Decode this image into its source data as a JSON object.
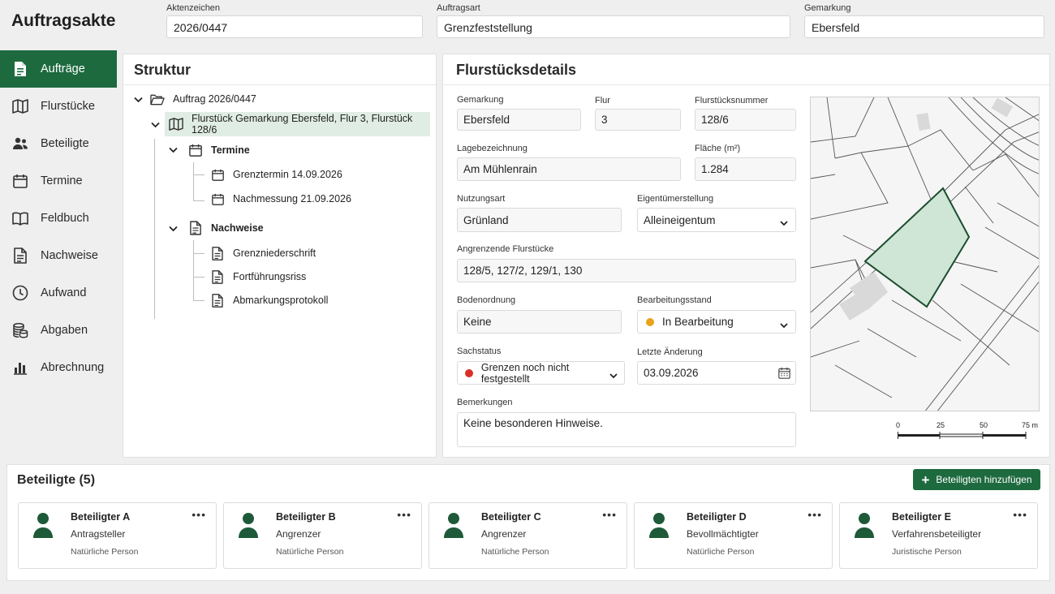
{
  "app": {
    "title": "Auftragsakte"
  },
  "header": {
    "aktenzeichen": {
      "label": "Aktenzeichen",
      "value": "2026/0447"
    },
    "auftragsart": {
      "label": "Auftragsart",
      "value": "Grenzfeststellung"
    },
    "gemarkung": {
      "label": "Gemarkung",
      "value": "Ebersfeld"
    }
  },
  "sidebar": {
    "items": [
      {
        "label": "Aufträge",
        "icon": "document-icon",
        "active": true
      },
      {
        "label": "Flurstücke",
        "icon": "map-icon"
      },
      {
        "label": "Beteiligte",
        "icon": "people-icon"
      },
      {
        "label": "Termine",
        "icon": "calendar-icon"
      },
      {
        "label": "Feldbuch",
        "icon": "book-icon"
      },
      {
        "label": "Nachweise",
        "icon": "document-icon"
      },
      {
        "label": "Aufwand",
        "icon": "clock-icon"
      },
      {
        "label": "Abgaben",
        "icon": "coins-icon"
      },
      {
        "label": "Abrechnung",
        "icon": "bar-chart-icon"
      }
    ]
  },
  "structure": {
    "title": "Struktur",
    "root": "Auftrag 2026/0447",
    "parcel": "Flurstück Gemarkung Ebersfeld, Flur 3, Flurstück 128/6",
    "termine_label": "Termine",
    "termine": [
      "Grenztermin 14.09.2026",
      "Nachmessung 21.09.2026"
    ],
    "nachweise_label": "Nachweise",
    "nachweise": [
      "Grenzniederschrift",
      "Fortführungsriss",
      "Abmarkungsprotokoll"
    ]
  },
  "details": {
    "title": "Flurstücksdetails",
    "gemarkung": {
      "label": "Gemarkung",
      "value": "Ebersfeld"
    },
    "flur": {
      "label": "Flur",
      "value": "3"
    },
    "flurstuecksnummer": {
      "label": "Flurstücksnummer",
      "value": "128/6"
    },
    "lagebezeichnung": {
      "label": "Lagebezeichnung",
      "value": "Am Mühlenrain"
    },
    "flaeche": {
      "label": "Fläche (m²)",
      "value": "1.284"
    },
    "nutzungsart": {
      "label": "Nutzungsart",
      "value": "Grünland"
    },
    "eigentuemerstellung": {
      "label": "Eigentümerstellung",
      "value": "Alleineigentum"
    },
    "angrenzende": {
      "label": "Angrenzende Flurstücke",
      "value": "128/5, 127/2, 129/1, 130"
    },
    "bodenordnung": {
      "label": "Bodenordnung",
      "value": "Keine"
    },
    "bearbeitungsstand": {
      "label": "Bearbeitungsstand",
      "value": "In Bearbeitung",
      "color": "#e8a317"
    },
    "sachstatus": {
      "label": "Sachstatus",
      "value": "Grenzen noch nicht festgestellt",
      "color": "#d93025"
    },
    "letzte_aenderung": {
      "label": "Letzte Änderung",
      "value": "03.09.2026"
    },
    "bemerkungen": {
      "label": "Bemerkungen",
      "value": "Keine besonderen Hinweise."
    },
    "scale": {
      "ticks": [
        "0",
        "25",
        "50",
        "75 m"
      ]
    }
  },
  "participants": {
    "title": "Beteiligte (5)",
    "add_label": "Beteiligten hinzufügen",
    "items": [
      {
        "name": "Beteiligter A",
        "role": "Antragsteller",
        "type": "Natürliche Person"
      },
      {
        "name": "Beteiligter B",
        "role": "Angrenzer",
        "type": "Natürliche Person"
      },
      {
        "name": "Beteiligter C",
        "role": "Angrenzer",
        "type": "Natürliche Person"
      },
      {
        "name": "Beteiligter D",
        "role": "Bevollmächtigter",
        "type": "Natürliche Person"
      },
      {
        "name": "Beteiligter E",
        "role": "Verfahrensbeteiligter",
        "type": "Juristische Person"
      }
    ]
  },
  "colors": {
    "accent": "#1d6a3f",
    "parcel_fill": "#cfe5d6",
    "parcel_stroke": "#1b4d2e"
  }
}
